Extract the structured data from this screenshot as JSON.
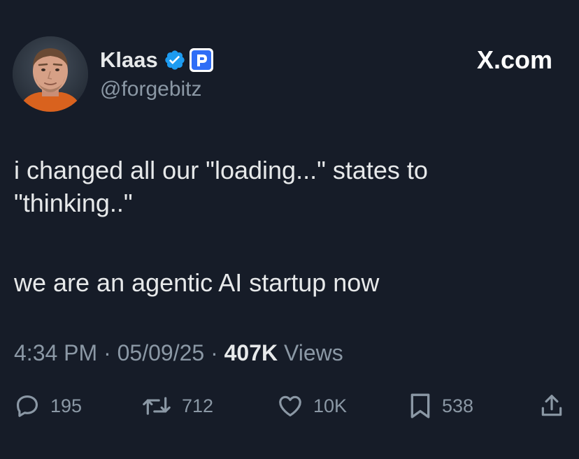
{
  "app": {
    "brand": "X.com"
  },
  "author": {
    "display_name": "Klaas",
    "handle": "@forgebitz",
    "verified_icon": "verified-badge-icon",
    "affiliate_icon": "affiliate-badge-icon"
  },
  "tweet": {
    "line1": "i changed all our \"loading...\" states to",
    "line2": "\"thinking..\"",
    "line3": "we are an agentic AI startup now"
  },
  "meta": {
    "time": "4:34 PM",
    "separator": "·",
    "date": "05/09/25",
    "views_count": "407K",
    "views_label": "Views"
  },
  "actions": {
    "replies": "195",
    "reposts": "712",
    "likes": "10K",
    "bookmarks": "538"
  },
  "colors": {
    "background": "#161c28",
    "text": "#e7e9ea",
    "muted": "#8b98a5",
    "verified": "#1d9bf0",
    "affiliate": "#2f6df6"
  }
}
